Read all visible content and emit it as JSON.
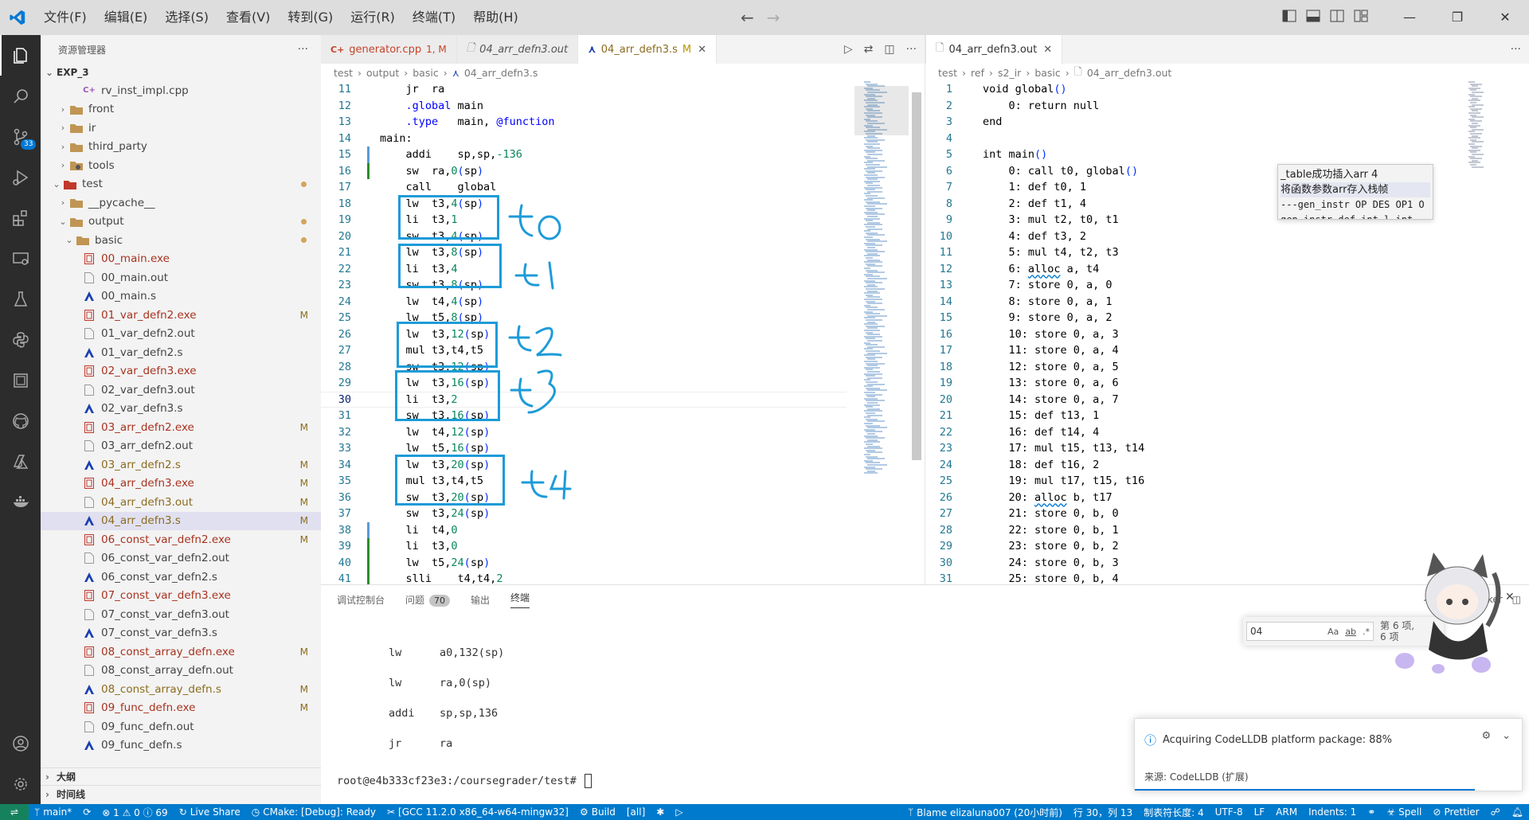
{
  "menu": [
    "文件(F)",
    "编辑(E)",
    "选择(S)",
    "查看(V)",
    "转到(G)",
    "运行(R)",
    "终端(T)",
    "帮助(H)"
  ],
  "activity": {
    "scm_badge": "33"
  },
  "sidebar": {
    "title": "资源管理器",
    "root": "EXP_3",
    "items": [
      {
        "name": "rv_inst_impl.cpp",
        "kind": "cpp",
        "depth": 3
      },
      {
        "name": "front",
        "kind": "folder",
        "depth": 1,
        "chev": "›"
      },
      {
        "name": "ir",
        "kind": "folder",
        "depth": 1,
        "chev": "›"
      },
      {
        "name": "third_party",
        "kind": "folder",
        "depth": 1,
        "chev": "›"
      },
      {
        "name": "tools",
        "kind": "folder-tools",
        "depth": 1,
        "chev": "›"
      },
      {
        "name": "test",
        "kind": "folder-test",
        "depth": 0,
        "chev": "⌄",
        "dot": true
      },
      {
        "name": "__pycache__",
        "kind": "folder",
        "depth": 1,
        "chev": "›"
      },
      {
        "name": "output",
        "kind": "folder",
        "depth": 1,
        "chev": "⌄",
        "dot": true
      },
      {
        "name": "basic",
        "kind": "folder",
        "depth": 2,
        "chev": "⌄",
        "dot": true
      },
      {
        "name": "00_main.exe",
        "kind": "exe",
        "depth": 3
      },
      {
        "name": "00_main.out",
        "kind": "file",
        "depth": 3
      },
      {
        "name": "00_main.s",
        "kind": "asm",
        "depth": 3
      },
      {
        "name": "01_var_defn2.exe",
        "kind": "exe",
        "depth": 3,
        "status": "M"
      },
      {
        "name": "01_var_defn2.out",
        "kind": "file",
        "depth": 3
      },
      {
        "name": "01_var_defn2.s",
        "kind": "asm",
        "depth": 3
      },
      {
        "name": "02_var_defn3.exe",
        "kind": "exe",
        "depth": 3
      },
      {
        "name": "02_var_defn3.out",
        "kind": "file",
        "depth": 3
      },
      {
        "name": "02_var_defn3.s",
        "kind": "asm",
        "depth": 3
      },
      {
        "name": "03_arr_defn2.exe",
        "kind": "exe",
        "depth": 3,
        "status": "M"
      },
      {
        "name": "03_arr_defn2.out",
        "kind": "file",
        "depth": 3
      },
      {
        "name": "03_arr_defn2.s",
        "kind": "asm",
        "depth": 3,
        "status": "M"
      },
      {
        "name": "04_arr_defn3.exe",
        "kind": "exe",
        "depth": 3,
        "status": "M"
      },
      {
        "name": "04_arr_defn3.out",
        "kind": "file",
        "depth": 3,
        "status": "M"
      },
      {
        "name": "04_arr_defn3.s",
        "kind": "asm",
        "depth": 3,
        "status": "M",
        "selected": true
      },
      {
        "name": "06_const_var_defn2.exe",
        "kind": "exe",
        "depth": 3,
        "status": "M"
      },
      {
        "name": "06_const_var_defn2.out",
        "kind": "file",
        "depth": 3
      },
      {
        "name": "06_const_var_defn2.s",
        "kind": "asm",
        "depth": 3
      },
      {
        "name": "07_const_var_defn3.exe",
        "kind": "exe",
        "depth": 3
      },
      {
        "name": "07_const_var_defn3.out",
        "kind": "file",
        "depth": 3
      },
      {
        "name": "07_const_var_defn3.s",
        "kind": "asm",
        "depth": 3
      },
      {
        "name": "08_const_array_defn.exe",
        "kind": "exe",
        "depth": 3,
        "status": "M"
      },
      {
        "name": "08_const_array_defn.out",
        "kind": "file",
        "depth": 3
      },
      {
        "name": "08_const_array_defn.s",
        "kind": "asm",
        "depth": 3,
        "status": "M"
      },
      {
        "name": "09_func_defn.exe",
        "kind": "exe",
        "depth": 3,
        "status": "M"
      },
      {
        "name": "09_func_defn.out",
        "kind": "file",
        "depth": 3
      },
      {
        "name": "09_func_defn.s",
        "kind": "asm",
        "depth": 3
      }
    ],
    "outline": "大纲",
    "timeline": "时间线"
  },
  "editor1": {
    "tabs": [
      {
        "label": "generator.cpp",
        "extra": "1, M",
        "kind": "cpp"
      },
      {
        "label": "04_arr_defn3.out",
        "extra": "",
        "kind": "file",
        "italic": true
      },
      {
        "label": "04_arr_defn3.s",
        "extra": "M",
        "kind": "asm",
        "active": true
      }
    ],
    "breadcrumb": [
      "test",
      "output",
      "basic",
      "04_arr_defn3.s"
    ],
    "lines": [
      {
        "n": "11",
        "t": "    jr  ra"
      },
      {
        "n": "12",
        "t": "    .global main"
      },
      {
        "n": "13",
        "t": "    .type   main, @function"
      },
      {
        "n": "14",
        "t": "main:"
      },
      {
        "n": "15",
        "t": "    addi    sp,sp,-136"
      },
      {
        "n": "16",
        "t": "    sw  ra,0(sp)"
      },
      {
        "n": "17",
        "t": "    call    global"
      },
      {
        "n": "18",
        "t": "    lw  t3,4(sp)"
      },
      {
        "n": "19",
        "t": "    li  t3,1"
      },
      {
        "n": "20",
        "t": "    sw  t3,4(sp)"
      },
      {
        "n": "21",
        "t": "    lw  t3,8(sp)"
      },
      {
        "n": "22",
        "t": "    li  t3,4"
      },
      {
        "n": "23",
        "t": "    sw  t3,8(sp)"
      },
      {
        "n": "24",
        "t": "    lw  t4,4(sp)"
      },
      {
        "n": "25",
        "t": "    lw  t5,8(sp)"
      },
      {
        "n": "26",
        "t": "    lw  t3,12(sp)"
      },
      {
        "n": "27",
        "t": "    mul t3,t4,t5"
      },
      {
        "n": "28",
        "t": "    sw  t3,12(sp)"
      },
      {
        "n": "29",
        "t": "    lw  t3,16(sp)"
      },
      {
        "n": "30",
        "t": "    li  t3,2"
      },
      {
        "n": "31",
        "t": "    sw  t3,16(sp)"
      },
      {
        "n": "32",
        "t": "    lw  t4,12(sp)"
      },
      {
        "n": "33",
        "t": "    lw  t5,16(sp)"
      },
      {
        "n": "34",
        "t": "    lw  t3,20(sp)"
      },
      {
        "n": "35",
        "t": "    mul t3,t4,t5"
      },
      {
        "n": "36",
        "t": "    sw  t3,20(sp)"
      },
      {
        "n": "37",
        "t": "    sw  t3,24(sp)"
      },
      {
        "n": "38",
        "t": "    li  t4,0"
      },
      {
        "n": "39",
        "t": "    li  t3,0"
      },
      {
        "n": "40",
        "t": "    lw  t5,24(sp)"
      },
      {
        "n": "41",
        "t": "    slli    t4,t4,2"
      }
    ],
    "annotations": [
      "t0",
      "t1",
      "t2",
      "t3",
      "t4"
    ]
  },
  "editor2": {
    "tab": "04_arr_defn3.out",
    "breadcrumb": [
      "test",
      "ref",
      "s2_ir",
      "basic",
      "04_arr_defn3.out"
    ],
    "lines": [
      {
        "n": "1",
        "t": "void global()"
      },
      {
        "n": "2",
        "t": "    0: return null"
      },
      {
        "n": "3",
        "t": "end"
      },
      {
        "n": "4",
        "t": ""
      },
      {
        "n": "5",
        "t": "int main()"
      },
      {
        "n": "6",
        "t": "    0: call t0, global()"
      },
      {
        "n": "7",
        "t": "    1: def t0, 1"
      },
      {
        "n": "8",
        "t": "    2: def t1, 4"
      },
      {
        "n": "9",
        "t": "    3: mul t2, t0, t1"
      },
      {
        "n": "10",
        "t": "    4: def t3, 2"
      },
      {
        "n": "11",
        "t": "    5: mul t4, t2, t3"
      },
      {
        "n": "12",
        "t": "    6: alloc a, t4"
      },
      {
        "n": "13",
        "t": "    7: store 0, a, 0"
      },
      {
        "n": "14",
        "t": "    8: store 0, a, 1"
      },
      {
        "n": "15",
        "t": "    9: store 0, a, 2"
      },
      {
        "n": "16",
        "t": "    10: store 0, a, 3"
      },
      {
        "n": "17",
        "t": "    11: store 0, a, 4"
      },
      {
        "n": "18",
        "t": "    12: store 0, a, 5"
      },
      {
        "n": "19",
        "t": "    13: store 0, a, 6"
      },
      {
        "n": "20",
        "t": "    14: store 0, a, 7"
      },
      {
        "n": "21",
        "t": "    15: def t13, 1"
      },
      {
        "n": "22",
        "t": "    16: def t14, 4"
      },
      {
        "n": "23",
        "t": "    17: mul t15, t13, t14"
      },
      {
        "n": "24",
        "t": "    18: def t16, 2"
      },
      {
        "n": "25",
        "t": "    19: mul t17, t15, t16"
      },
      {
        "n": "26",
        "t": "    20: alloc b, t17"
      },
      {
        "n": "27",
        "t": "    21: store 0, b, 0"
      },
      {
        "n": "28",
        "t": "    22: store 0, b, 1"
      },
      {
        "n": "29",
        "t": "    23: store 0, b, 2"
      },
      {
        "n": "30",
        "t": "    24: store 0, b, 3"
      },
      {
        "n": "31",
        "t": "    25: store 0, b, 4"
      }
    ],
    "hover": [
      "_table成功插入arr 4",
      "将函数参数arr存入栈帧",
      "---gen_instr OP DES OP1 O",
      "gen_instr def int l int"
    ]
  },
  "panel": {
    "tabs": [
      {
        "label": "调试控制台"
      },
      {
        "label": "问题",
        "badge": "70"
      },
      {
        "label": "输出"
      },
      {
        "label": "终端",
        "active": true
      }
    ],
    "terminal_kind": "docker",
    "terminal": [
      {
        "op": "lw",
        "arg": "a0,132(sp)"
      },
      {
        "op": "lw",
        "arg": "ra,0(sp)"
      },
      {
        "op": "addi",
        "arg": "sp,sp,136"
      },
      {
        "op": "jr",
        "arg": "ra"
      }
    ],
    "prompt": "root@e4b333cf23e3:/coursegrader/test# ",
    "find": {
      "value": "04",
      "options": [
        "Aa",
        "ab",
        ".*"
      ],
      "count_line1": "第 6 项,",
      "count_line2": "6 项"
    }
  },
  "notification": {
    "message": "Acquiring CodeLLDB platform package: 88%",
    "source": "来源: CodeLLDB (扩展)"
  },
  "statusbar": {
    "branch": "main*",
    "problems": "⊗ 1 ⚠ 0 ⓘ 69",
    "liveshare": "Live Share",
    "cmake": "CMake: [Debug]: Ready",
    "kit": "[GCC 11.2.0 x86_64-w64-mingw32]",
    "build": "Build",
    "target": "[all]",
    "blame": "Blame elizaluna007 (20小时前)",
    "position": "行 30，列 13",
    "tabsize": "制表符长度: 4",
    "encoding": "UTF-8",
    "eol": "LF",
    "lang": "ARM",
    "indents": "Indents: 1",
    "spell": "Spell",
    "prettier": "Prettier"
  },
  "colors": {
    "accent": "#007acc",
    "annotation": "#1d9bd8",
    "activity_bg": "#2c2c2c"
  }
}
